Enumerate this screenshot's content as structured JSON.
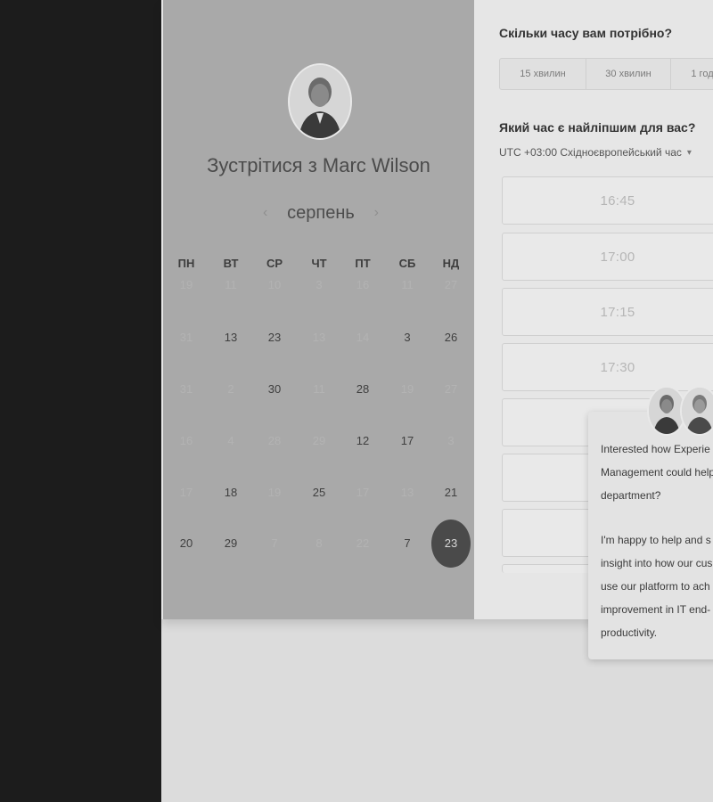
{
  "calendar": {
    "title": "Зустрітися з Marc Wilson",
    "month": "серпень",
    "prev": "‹",
    "next": "›",
    "weekdays": [
      "ПН",
      "ВТ",
      "СР",
      "ЧТ",
      "ПТ",
      "СБ",
      "НД"
    ],
    "weeks": [
      [
        {
          "t": "19",
          "d": true
        },
        {
          "t": "11",
          "d": true
        },
        {
          "t": "10",
          "d": true
        },
        {
          "t": "3",
          "d": true
        },
        {
          "t": "16",
          "d": true
        },
        {
          "t": "11",
          "d": true
        },
        {
          "t": "27",
          "d": true
        }
      ],
      [
        {
          "t": "31",
          "d": true
        },
        {
          "t": "13",
          "d": false
        },
        {
          "t": "23",
          "d": false
        },
        {
          "t": "13",
          "d": true
        },
        {
          "t": "14",
          "d": true
        },
        {
          "t": "3",
          "d": false
        },
        {
          "t": "26",
          "d": false
        }
      ],
      [
        {
          "t": "31",
          "d": true
        },
        {
          "t": "2",
          "d": true
        },
        {
          "t": "30",
          "d": false
        },
        {
          "t": "11",
          "d": true
        },
        {
          "t": "28",
          "d": false
        },
        {
          "t": "19",
          "d": true
        },
        {
          "t": "27",
          "d": true
        }
      ],
      [
        {
          "t": "16",
          "d": true
        },
        {
          "t": "4",
          "d": true
        },
        {
          "t": "28",
          "d": true
        },
        {
          "t": "29",
          "d": true
        },
        {
          "t": "12",
          "d": false
        },
        {
          "t": "17",
          "d": false
        },
        {
          "t": "3",
          "d": true
        }
      ],
      [
        {
          "t": "17",
          "d": true
        },
        {
          "t": "18",
          "d": false
        },
        {
          "t": "19",
          "d": true
        },
        {
          "t": "25",
          "d": false
        },
        {
          "t": "17",
          "d": true
        },
        {
          "t": "13",
          "d": true
        },
        {
          "t": "21",
          "d": false
        }
      ],
      [
        {
          "t": "20",
          "d": false
        },
        {
          "t": "29",
          "d": false
        },
        {
          "t": "7",
          "d": true
        },
        {
          "t": "8",
          "d": true
        },
        {
          "t": "22",
          "d": true
        },
        {
          "t": "7",
          "d": false
        },
        {
          "t": "23",
          "d": false,
          "sel": true
        }
      ]
    ]
  },
  "duration": {
    "question": "Скільки часу вам потрібно?",
    "options": [
      "15 хвилин",
      "30 хвилин",
      "1 год"
    ]
  },
  "time": {
    "question": "Який час є найліпшим для вас?",
    "timezone": "UTC +03:00 Східноєвропейський час",
    "slots": [
      "16:45",
      "17:00",
      "17:15",
      "17:30",
      "",
      "",
      ""
    ]
  },
  "chat": {
    "line1": "Interested how Experie",
    "line2": "Management could help",
    "line3": "department?",
    "line4": "I'm happy to help and s",
    "line5": "insight into how our cus",
    "line6": "use our platform to ach",
    "line7": "improvement in IT end-",
    "line8": "productivity."
  },
  "icons": {
    "caret": "▾"
  }
}
